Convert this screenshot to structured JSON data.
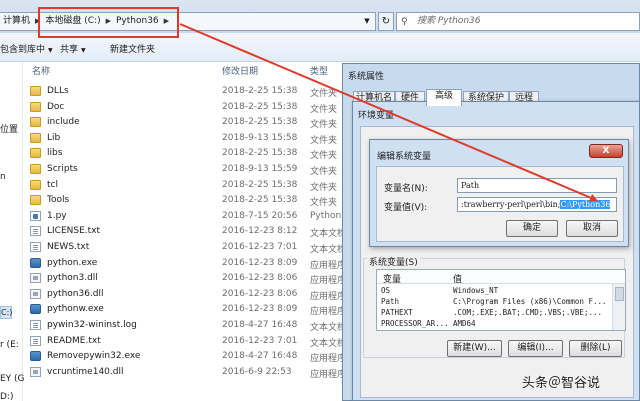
{
  "explorer": {
    "breadcrumb": [
      "计算机",
      "本地磁盘 (C:)",
      "Python36"
    ],
    "search_placeholder": "搜索 Python36",
    "toolbar": {
      "include_in_library": "包含到库中",
      "share": "共享",
      "new_folder": "新建文件夹"
    },
    "columns": {
      "name": "名称",
      "modified": "修改日期",
      "type": "类型"
    },
    "nav_fragments": [
      "位置",
      "n",
      "C:)",
      "r (E:",
      "EY (G",
      "D:)"
    ],
    "files": [
      {
        "name": "DLLs",
        "date": "2018-2-25 15:38",
        "type": "文件夹",
        "kind": "folder"
      },
      {
        "name": "Doc",
        "date": "2018-2-25 15:38",
        "type": "文件夹",
        "kind": "folder"
      },
      {
        "name": "include",
        "date": "2018-2-25 15:38",
        "type": "文件夹",
        "kind": "folder"
      },
      {
        "name": "Lib",
        "date": "2018-9-13 15:58",
        "type": "文件夹",
        "kind": "folder"
      },
      {
        "name": "libs",
        "date": "2018-2-25 15:38",
        "type": "文件夹",
        "kind": "folder"
      },
      {
        "name": "Scripts",
        "date": "2018-9-13 15:59",
        "type": "文件夹",
        "kind": "folder"
      },
      {
        "name": "tcl",
        "date": "2018-2-25 15:38",
        "type": "文件夹",
        "kind": "folder"
      },
      {
        "name": "Tools",
        "date": "2018-2-25 15:38",
        "type": "文件夹",
        "kind": "folder"
      },
      {
        "name": "1.py",
        "date": "2018-7-15 20:56",
        "type": "Python",
        "kind": "py"
      },
      {
        "name": "LICENSE.txt",
        "date": "2016-12-23 8:12",
        "type": "文本文档",
        "kind": "txt"
      },
      {
        "name": "NEWS.txt",
        "date": "2016-12-23 7:01",
        "type": "文本文档",
        "kind": "txt"
      },
      {
        "name": "python.exe",
        "date": "2016-12-23 8:09",
        "type": "应用程序",
        "kind": "exe"
      },
      {
        "name": "python3.dll",
        "date": "2016-12-23 8:06",
        "type": "应用程序",
        "kind": "dll"
      },
      {
        "name": "python36.dll",
        "date": "2016-12-23 8:06",
        "type": "应用程序",
        "kind": "dll"
      },
      {
        "name": "pythonw.exe",
        "date": "2016-12-23 8:09",
        "type": "应用程序",
        "kind": "exe"
      },
      {
        "name": "pywin32-wininst.log",
        "date": "2018-4-27 16:48",
        "type": "文本文档",
        "kind": "txt"
      },
      {
        "name": "README.txt",
        "date": "2016-12-23 7:01",
        "type": "文本文档",
        "kind": "txt"
      },
      {
        "name": "Removepywin32.exe",
        "date": "2018-4-27 16:48",
        "type": "应用程序",
        "kind": "exe"
      },
      {
        "name": "vcruntime140.dll",
        "date": "2016-6-9 22:53",
        "type": "应用程序",
        "kind": "dll"
      }
    ]
  },
  "system_properties": {
    "title": "系统属性",
    "tabs": [
      "计算机名",
      "硬件",
      "高级",
      "系统保护",
      "远程"
    ],
    "active_tab": "高级"
  },
  "env_vars": {
    "title": "环境变量",
    "system_vars_label": "系统变量(S)",
    "columns": {
      "variable": "变量",
      "value": "值"
    },
    "rows": [
      {
        "name": "OS",
        "value": "Windows_NT"
      },
      {
        "name": "Path",
        "value": "C:\\Program Files (x86)\\Common F..."
      },
      {
        "name": "PATHEXT",
        "value": ".COM;.EXE;.BAT;.CMD;.VBS;.VBE;..."
      },
      {
        "name": "PROCESSOR_AR...",
        "value": "AMD64"
      }
    ],
    "buttons": {
      "new": "新建(W)...",
      "edit": "编辑(I)...",
      "delete": "删除(L)"
    }
  },
  "edit_var": {
    "title": "编辑系统变量",
    "close": "X",
    "name_label": "变量名(N):",
    "name_value": "Path",
    "value_label": "变量值(V):",
    "value_text": ":trawberry-perl\\perl\\bin;",
    "value_selected": "C:\\Python36",
    "ok": "确定",
    "cancel": "取消"
  },
  "watermark": "头条＠智谷说",
  "colors": {
    "annotation_red": "#e03a2c",
    "selection_blue": "#3399ff"
  }
}
